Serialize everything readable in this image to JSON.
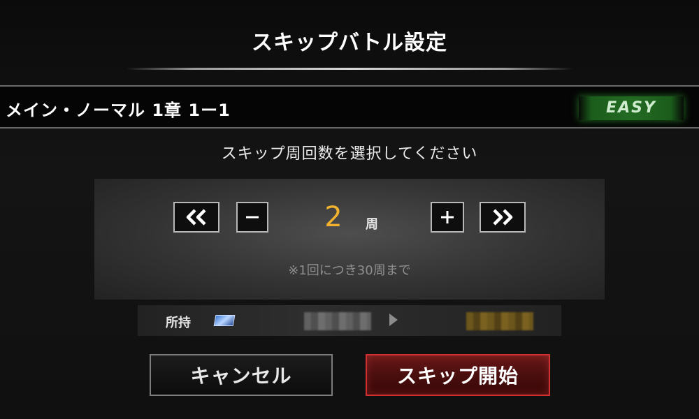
{
  "dialog": {
    "title": "スキップバトル設定"
  },
  "stage": {
    "name": "メイン・ノーマル 1章 1ー1",
    "difficulty": "EASY",
    "difficulty_color": "#236b23"
  },
  "instruction": "スキップ周回数を選択してください",
  "counter": {
    "decrease_max_icon": "double-chevron-left-icon",
    "decrease_icon": "minus-icon",
    "value": "2",
    "unit": "周",
    "increase_icon": "plus-icon",
    "increase_max_icon": "double-chevron-right-icon",
    "note": "※1回につき30周まで",
    "value_color": "#f2b230"
  },
  "possession": {
    "label": "所持",
    "item_icon": "ticket-icon",
    "arrow_icon": "triangle-right-icon"
  },
  "buttons": {
    "cancel_label": "キャンセル",
    "start_label": "スキップ開始",
    "start_color": "#d23030"
  }
}
